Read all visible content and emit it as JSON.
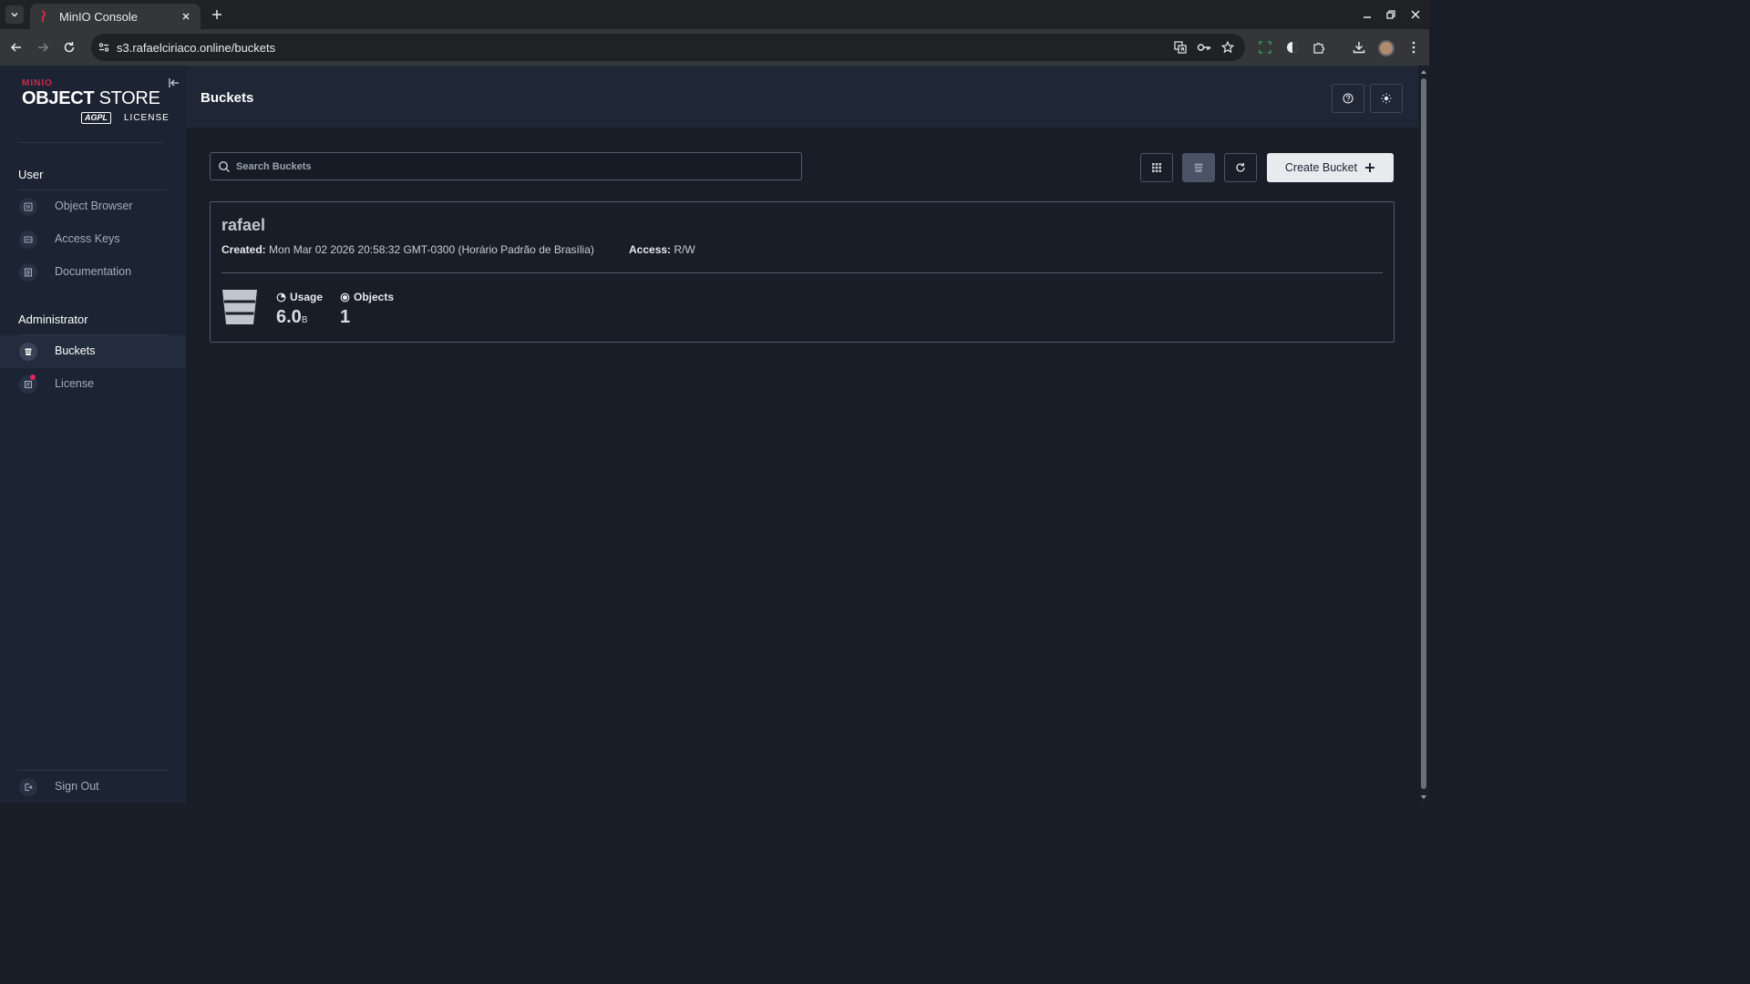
{
  "browser": {
    "tab_title": "MinIO Console",
    "url": "s3.rafaelciriaco.online/buckets"
  },
  "logo": {
    "brand": "MINIO",
    "product_bold": "OBJECT",
    "product_rest": " STORE",
    "license_mark": "AGPL",
    "license_word": "LICENSE"
  },
  "sidebar": {
    "user_heading": "User",
    "user_items": [
      {
        "label": "Object Browser",
        "icon": "object-browser-icon"
      },
      {
        "label": "Access Keys",
        "icon": "access-keys-icon"
      },
      {
        "label": "Documentation",
        "icon": "documentation-icon"
      }
    ],
    "admin_heading": "Administrator",
    "admin_items": [
      {
        "label": "Buckets",
        "icon": "bucket-icon",
        "active": true
      },
      {
        "label": "License",
        "icon": "license-icon",
        "badge": true
      }
    ],
    "sign_out": "Sign Out"
  },
  "header": {
    "title": "Buckets"
  },
  "toolbar": {
    "search_placeholder": "Search Buckets",
    "create_label": "Create Bucket"
  },
  "buckets": [
    {
      "name": "rafael",
      "created_label": "Created:",
      "created_value": "Mon Mar 02 2026 20:58:32 GMT-0300 (Horário Padrão de Brasília)",
      "access_label": "Access:",
      "access_value": "R/W",
      "usage_label": "Usage",
      "usage_value": "6.0",
      "usage_unit": "B",
      "objects_label": "Objects",
      "objects_value": "1"
    }
  ],
  "colors": {
    "accent": "#c72c48",
    "background": "#181d27",
    "sidebar": "#1c2433"
  }
}
